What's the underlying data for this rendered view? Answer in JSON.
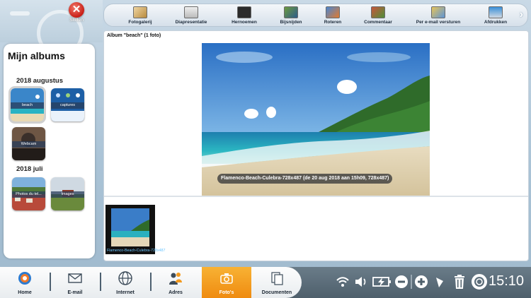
{
  "header": {
    "close_label": "Sluiten"
  },
  "toolbar": {
    "items": [
      {
        "label": "Fotogalerij",
        "icon": "photo-gallery-icon"
      },
      {
        "label": "Diapresentatie",
        "icon": "slideshow-icon"
      },
      {
        "label": "Hernoemen",
        "icon": "rename-icon"
      },
      {
        "label": "Bijsnijden",
        "icon": "crop-icon"
      },
      {
        "label": "Roteren",
        "icon": "rotate-icon"
      },
      {
        "label": "Commentaar",
        "icon": "comment-icon"
      },
      {
        "label": "Per e-mail versturen",
        "icon": "email-send-icon"
      },
      {
        "label": "Afdrukken",
        "icon": "printer-icon"
      }
    ]
  },
  "sidebar": {
    "title": "Mijn albums",
    "groups": [
      {
        "label": "2018 augustus",
        "albums": [
          {
            "label": "beach"
          },
          {
            "label": "captures"
          },
          {
            "label": "Webcam"
          }
        ]
      },
      {
        "label": "2018 juli",
        "albums": [
          {
            "label": "Photos du tel..."
          },
          {
            "label": "Images"
          }
        ]
      }
    ]
  },
  "main": {
    "album_title": "Album \"beach\" (1 foto)",
    "photo_caption": "Flamenco-Beach-Culebra-728x487 (de 20 aug 2018 aan 15h09, 728x487)",
    "thumbnail_label": "Flamenco-Beach-Culebra-728x487"
  },
  "dock": {
    "items": [
      {
        "label": "Home",
        "icon": "home-icon"
      },
      {
        "label": "E-mail",
        "icon": "envelope-icon"
      },
      {
        "label": "Internet",
        "icon": "globe-icon"
      },
      {
        "label": "Adres",
        "icon": "contacts-icon"
      },
      {
        "label": "Foto's",
        "icon": "camera-icon",
        "active": true
      },
      {
        "label": "Documenten",
        "icon": "documents-icon"
      }
    ]
  },
  "status": {
    "time": "15:10"
  },
  "colors": {
    "accent": "#f39a1e",
    "close": "#d9261c"
  }
}
